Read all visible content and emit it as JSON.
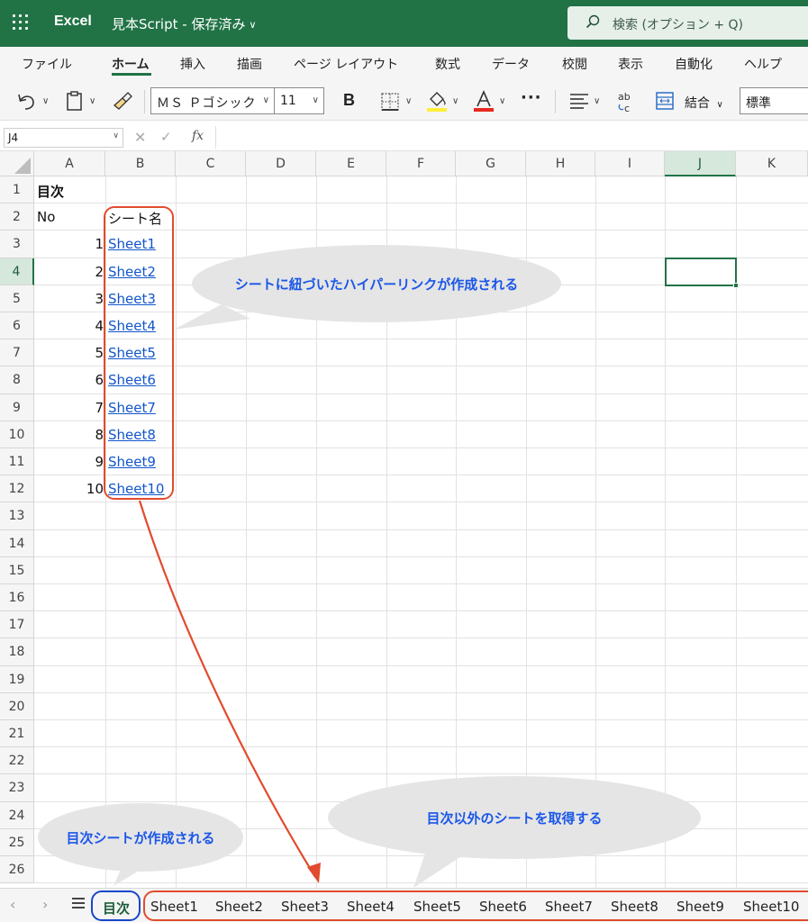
{
  "titlebar": {
    "app_name": "Excel",
    "doc_name": "見本Script - 保存済み",
    "search_text": "検索 (オプション + Q)"
  },
  "ribbon": {
    "tabs": [
      "ファイル",
      "ホーム",
      "挿入",
      "描画",
      "ページ レイアウト",
      "数式",
      "データ",
      "校閲",
      "表示",
      "自動化",
      "ヘルプ"
    ],
    "active_tab": "ホーム"
  },
  "toolbar": {
    "font_name": "ＭＳ Ｐゴシック",
    "font_size": "11",
    "bold_label": "B",
    "more_label": "···",
    "merge_label": "結合",
    "number_format": "標準"
  },
  "formula_bar": {
    "name_box": "J4",
    "fx_label": "fx",
    "formula": ""
  },
  "grid": {
    "columns": [
      "A",
      "B",
      "C",
      "D",
      "E",
      "F",
      "G",
      "H",
      "I",
      "J",
      "K"
    ],
    "selected_column": "J",
    "rows": [
      "1",
      "2",
      "3",
      "4",
      "5",
      "6",
      "7",
      "8",
      "9",
      "10",
      "11",
      "12",
      "13",
      "14",
      "15",
      "16",
      "17",
      "18",
      "19",
      "20",
      "21",
      "22",
      "23",
      "24",
      "25",
      "26"
    ],
    "selected_row": "4",
    "selected_cell": "J4",
    "cells": {
      "A1": "目次",
      "A2": "No",
      "B2": "シート名",
      "numbers": [
        "1",
        "2",
        "3",
        "4",
        "5",
        "6",
        "7",
        "8",
        "9",
        "10"
      ],
      "links": [
        "Sheet1",
        "Sheet2",
        "Sheet3",
        "Sheet4",
        "Sheet5",
        "Sheet6",
        "Sheet7",
        "Sheet8",
        "Sheet9",
        "Sheet10"
      ]
    }
  },
  "sheet_tabs": {
    "active": "目次",
    "others": [
      "Sheet1",
      "Sheet2",
      "Sheet3",
      "Sheet4",
      "Sheet5",
      "Sheet6",
      "Sheet7",
      "Sheet8",
      "Sheet9",
      "Sheet10"
    ]
  },
  "annotations": {
    "bubble_links": "シートに紐づいたハイパーリンクが作成される",
    "bubble_toc": "目次シートが作成される",
    "bubble_others": "目次以外のシートを取得する",
    "colors": {
      "red": "#e24b2e",
      "blue": "#1847c9",
      "bubble_text": "#1a56e8",
      "bubble_fill": "#e5e5e5"
    }
  },
  "theme": {
    "excel_green": "#217346",
    "link_blue": "#1155cc"
  }
}
